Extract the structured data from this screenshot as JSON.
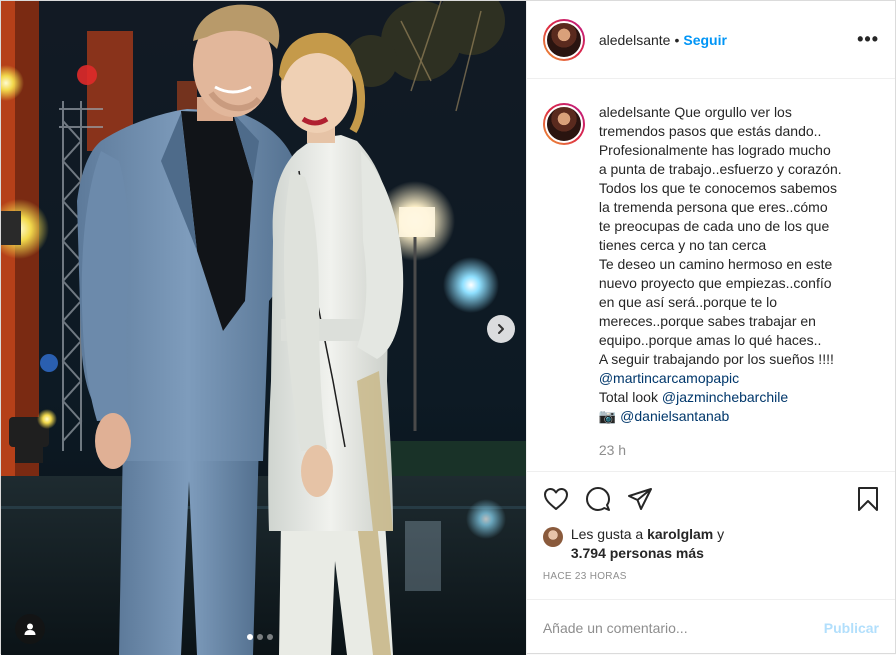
{
  "header": {
    "username": "aledelsante",
    "separator": "•",
    "follow_label": "Seguir",
    "more_label": "•••"
  },
  "caption": {
    "username": "aledelsante",
    "lines": [
      "Que orgullo ver los",
      "tremendos pasos que estás dando..",
      "Profesionalmente has logrado mucho",
      "a punta de trabajo..esfuerzo y corazón.",
      "Todos los que te conocemos sabemos",
      "la tremenda persona que eres..cómo",
      "te preocupas de cada uno de los que",
      "tienes cerca y no tan cerca",
      "Te deseo un camino hermoso en este",
      "nuevo proyecto que empiezas..confío",
      "en que así será..porque te lo",
      "mereces..porque sabes trabajar en",
      "equipo..porque amas lo qué haces..",
      "A seguir trabajando por los sueños !!!!"
    ],
    "mention1": "@martincarcamopapic",
    "total_look_label": "Total look",
    "mention2": "@jazminchebarchile",
    "camera_emoji": "📷",
    "mention3": "@danielsantanab",
    "time": "23 h"
  },
  "likes": {
    "prefix": "Les gusta a",
    "user": "karolglam",
    "and": "y",
    "count": "3.794 personas más"
  },
  "posted_ago": "HACE 23 HORAS",
  "comment_box": {
    "placeholder": "Añade un comentario...",
    "publish_label": "Publicar"
  },
  "carousel": {
    "total": 3,
    "active": 1
  },
  "colors": {
    "link": "#0095f6",
    "mention": "#00376b",
    "muted": "#8e8e8e",
    "publish_disabled": "#b2dffc"
  }
}
